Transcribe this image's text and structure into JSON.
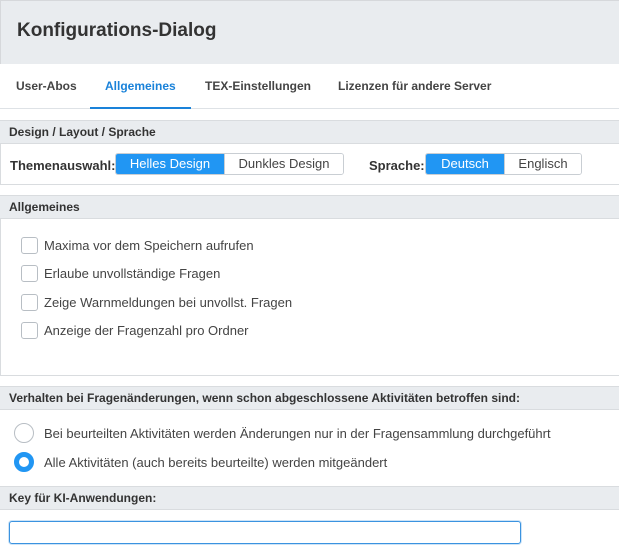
{
  "dialog": {
    "title": "Konfigurations-Dialog"
  },
  "tabs": [
    {
      "label": "User-Abos",
      "active": false
    },
    {
      "label": "Allgemeines",
      "active": true
    },
    {
      "label": "TEX-Einstellungen",
      "active": false
    },
    {
      "label": "Lizenzen für andere Server",
      "active": false
    }
  ],
  "design": {
    "header": "Design / Layout / Sprache",
    "theme_label": "Themenauswahl:",
    "theme_options": [
      "Helles Design",
      "Dunkles Design"
    ],
    "theme_selected": "Helles Design",
    "language_label": "Sprache:",
    "language_options": [
      "Deutsch",
      "Englisch"
    ],
    "language_selected": "Deutsch"
  },
  "general": {
    "header": "Allgemeines",
    "options": [
      {
        "label": "Maxima vor dem Speichern aufrufen",
        "checked": false
      },
      {
        "label": "Erlaube unvollständige Fragen",
        "checked": false
      },
      {
        "label": "Zeige Warnmeldungen bei unvollst. Fragen",
        "checked": false
      },
      {
        "label": "Anzeige der Fragenzahl pro Ordner",
        "checked": false
      }
    ]
  },
  "behavior": {
    "header": "Verhalten bei Fragenänderungen, wenn schon abgeschlossene Aktivitäten betroffen sind:",
    "options": [
      {
        "label": "Bei beurteilten Aktivitäten werden Änderungen nur in der Fragensammlung durchgeführt",
        "checked": false
      },
      {
        "label": "Alle Aktivitäten (auch bereits beurteilte) werden mitgeändert",
        "checked": true
      }
    ]
  },
  "ki_key": {
    "header": "Key für KI-Anwendungen:",
    "value": "",
    "placeholder": ""
  },
  "colors": {
    "accent": "#2196f3",
    "tab_active": "#1a82d9",
    "header_bg": "#e9ecef"
  }
}
